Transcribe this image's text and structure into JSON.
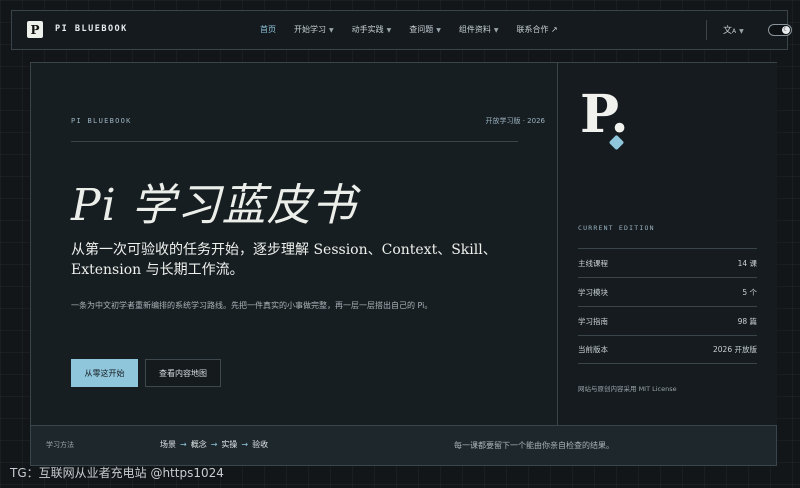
{
  "header": {
    "logo_mark": "P",
    "logo_text": "PI BLUEBOOK",
    "nav": [
      {
        "label": "首页",
        "active": true,
        "dropdown": false
      },
      {
        "label": "开始学习",
        "active": false,
        "dropdown": true
      },
      {
        "label": "动手实践",
        "active": false,
        "dropdown": true
      },
      {
        "label": "查问题",
        "active": false,
        "dropdown": true
      },
      {
        "label": "组件资料",
        "active": false,
        "dropdown": true
      },
      {
        "label": "联系合作 ↗",
        "active": false,
        "dropdown": false
      }
    ],
    "lang_icon": "translate-icon",
    "theme_icon": "moon-icon"
  },
  "hero": {
    "eyebrow": "PI BLUEBOOK",
    "edition_tag": "开放学习版 · 2026",
    "title": "Pi 学习蓝皮书",
    "subtitle": "从第一次可验收的任务开始，逐步理解 Session、Context、Skill、Extension 与长期工作流。",
    "description": "一条为中文初学者重新编排的系统学习路线。先把一件真实的小事做完整，再一层一层搭出自己的 Pi。",
    "primary_button": "从零这开始",
    "secondary_button": "查看内容地图"
  },
  "sidebar": {
    "logo_letter": "P.",
    "edition_label": "CURRENT EDITION",
    "stats": [
      {
        "label": "主线课程",
        "value": "14 课"
      },
      {
        "label": "学习模块",
        "value": "5 个"
      },
      {
        "label": "学习指南",
        "value": "98 篇"
      },
      {
        "label": "当前版本",
        "value": "2026 开放版"
      }
    ],
    "license": "网站与原创内容采用 MIT License"
  },
  "bottom": {
    "label": "学习方法",
    "steps": [
      "场景",
      "概念",
      "实操",
      "验收"
    ],
    "step_arrow": "→",
    "note": "每一课都要留下一个能由你亲自检查的结果。"
  },
  "watermark": "TG：互联网从业者充电站 @https1024",
  "colors": {
    "accent": "#8fc6dc",
    "background": "#121619",
    "panel": "#171e22"
  }
}
